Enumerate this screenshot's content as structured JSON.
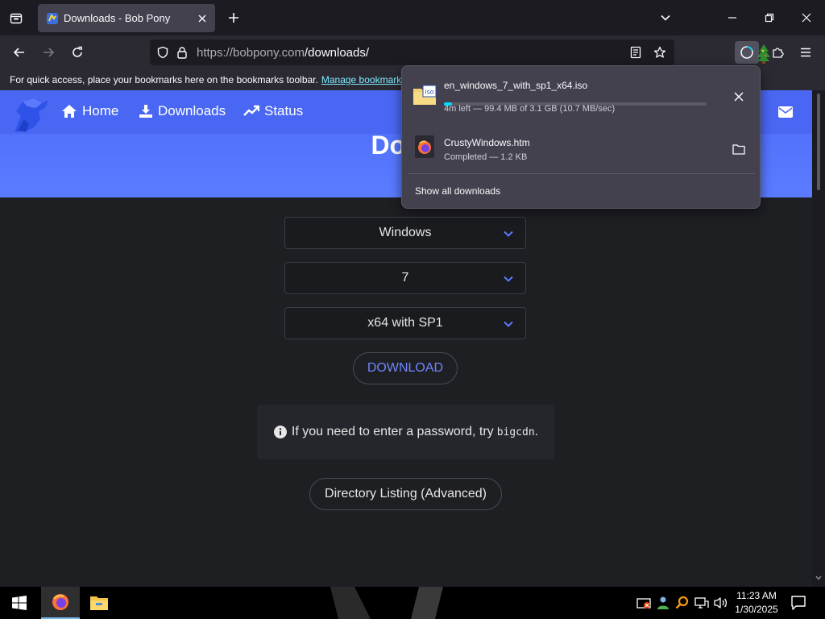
{
  "browser": {
    "tab_title": "Downloads - Bob Pony",
    "url_host": "https://bobpony.com",
    "url_path": "/downloads/",
    "bookmarks_hint": "For quick access, place your bookmarks here on the bookmarks toolbar.",
    "bookmarks_link": "Manage bookmarks"
  },
  "site": {
    "nav": [
      {
        "label": "Home",
        "icon": "home-icon"
      },
      {
        "label": "Downloads",
        "icon": "download-icon"
      },
      {
        "label": "Status",
        "icon": "chart-icon"
      }
    ],
    "hero_title": "Down",
    "selects": [
      "Windows",
      "7",
      "x64 with SP1"
    ],
    "download_button": "DOWNLOAD",
    "notice_text": "If you need to enter a password, try",
    "notice_code": "bigcdn",
    "notice_end": ".",
    "directory_button": "Directory Listing (Advanced)"
  },
  "downloads_panel": {
    "items": [
      {
        "name": "en_windows_7_with_sp1_x64.iso",
        "status": "4m left — 99.4 MB of 3.1 GB (10.7 MB/sec)",
        "progress": 0.03,
        "icon": "iso-file-icon"
      },
      {
        "name": "CrustyWindows.htm",
        "status": "Completed — 1.2 KB",
        "icon": "firefox-file-icon"
      }
    ],
    "show_all": "Show all downloads"
  },
  "taskbar": {
    "time": "11:23 AM",
    "date": "1/30/2025"
  },
  "colors": {
    "accent_blue": "#4a67f3",
    "progress": "#00ddff",
    "link": "#80ebff"
  }
}
